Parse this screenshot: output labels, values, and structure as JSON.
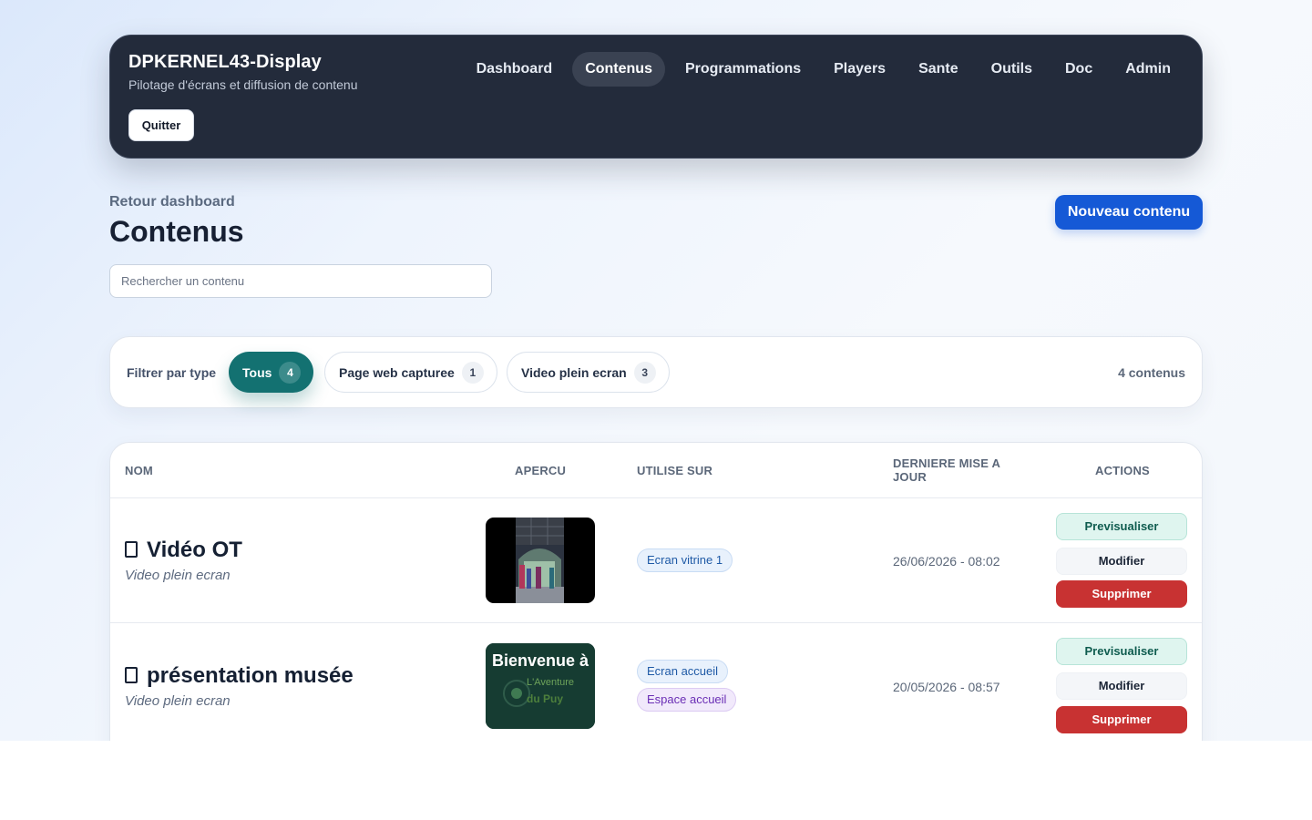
{
  "app": {
    "title": "DPKERNEL43-Display",
    "subtitle": "Pilotage d'écrans et diffusion de contenu",
    "quit_label": "Quitter"
  },
  "nav": [
    {
      "label": "Dashboard",
      "active": false
    },
    {
      "label": "Contenus",
      "active": true
    },
    {
      "label": "Programmations",
      "active": false
    },
    {
      "label": "Players",
      "active": false
    },
    {
      "label": "Sante",
      "active": false
    },
    {
      "label": "Outils",
      "active": false
    },
    {
      "label": "Doc",
      "active": false
    },
    {
      "label": "Admin",
      "active": false
    }
  ],
  "page": {
    "back_label": "Retour dashboard",
    "title": "Contenus",
    "new_button": "Nouveau contenu",
    "search_placeholder": "Rechercher un contenu"
  },
  "filters": {
    "label": "Filtrer par type",
    "chips": [
      {
        "label": "Tous",
        "count": "4",
        "active": true
      },
      {
        "label": "Page web capturee",
        "count": "1",
        "active": false
      },
      {
        "label": "Video plein ecran",
        "count": "3",
        "active": false
      }
    ],
    "total": "4 contenus"
  },
  "table": {
    "headers": {
      "name": "NOM",
      "preview": "APERCU",
      "used_on": "UTILISE SUR",
      "updated_line1": "DERNIERE MISE A",
      "updated_line2": "JOUR",
      "actions": "ACTIONS"
    },
    "actions": {
      "preview": "Previsualiser",
      "edit": "Modifier",
      "delete": "Supprimer"
    },
    "rows": [
      {
        "icon": "video-icon",
        "name": "Vidéo OT",
        "type": "Video plein ecran",
        "used_on": [
          "Ecran vitrine 1"
        ],
        "updated": "26/06/2026 - 08:02"
      },
      {
        "icon": "video-icon",
        "name": "présentation musée",
        "type": "Video plein ecran",
        "used_on": [
          "Ecran accueil",
          "Espace accueil"
        ],
        "updated": "20/05/2026 - 08:57",
        "thumb_text": {
          "line1": "Bienvenue à",
          "line2": "L'Aventure",
          "line3": "du Puy"
        }
      }
    ]
  },
  "colors": {
    "topbar": "#232b3b",
    "primary": "#1559d6",
    "chip_active": "#137171",
    "danger": "#c83232",
    "preview_bg": "#dff5ef"
  }
}
